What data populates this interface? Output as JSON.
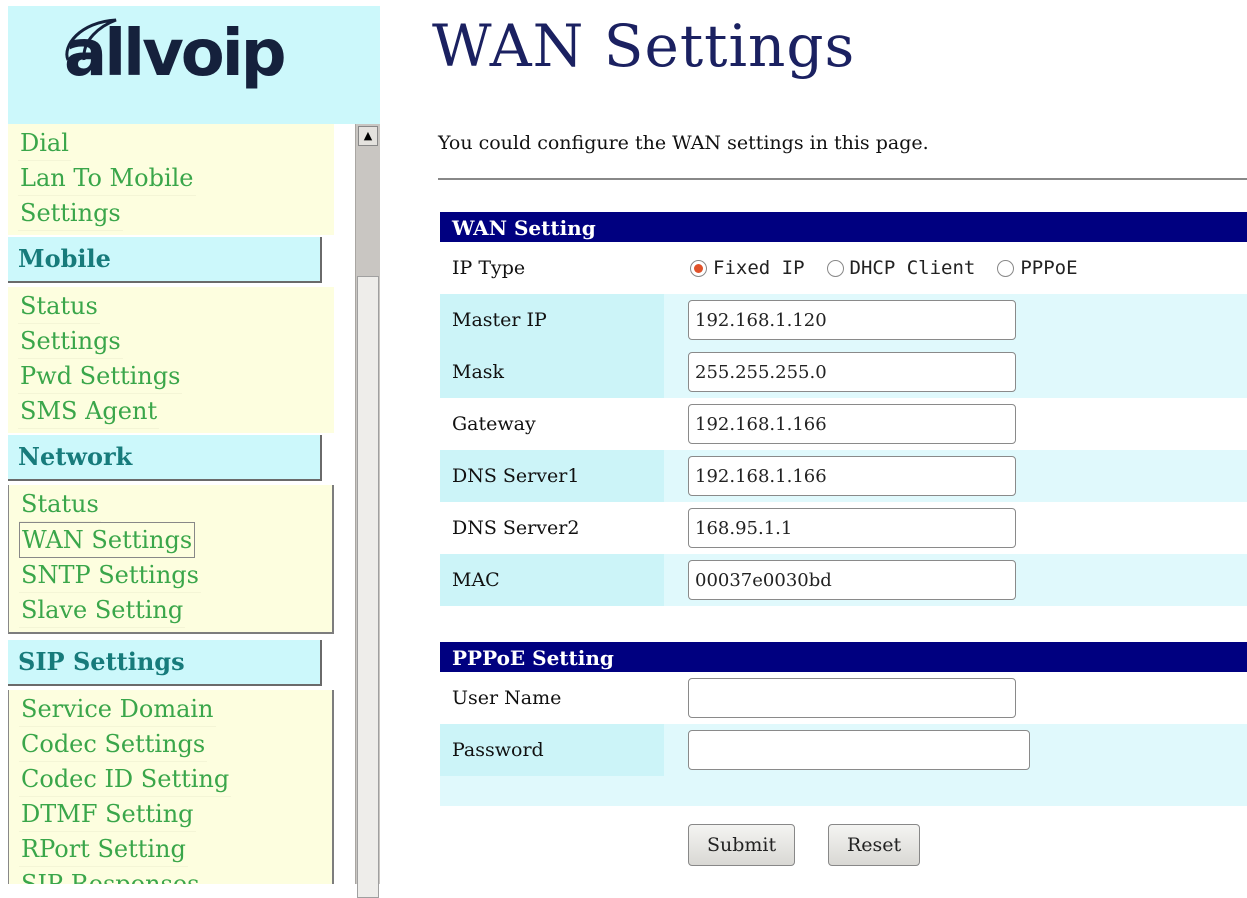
{
  "logo": {
    "text": "allvoip"
  },
  "sidebar": {
    "top_items": [
      "Dial",
      "Lan To Mobile",
      "Settings"
    ],
    "groups": [
      {
        "title": "Mobile",
        "items": [
          "Status",
          "Settings",
          "Pwd Settings",
          "SMS Agent"
        ]
      },
      {
        "title": "Network",
        "items": [
          "Status",
          "WAN Settings",
          "SNTP Settings",
          "Slave Setting"
        ]
      },
      {
        "title": "SIP Settings",
        "items": [
          "Service Domain",
          "Codec Settings",
          "Codec ID Setting",
          "DTMF Setting",
          "RPort Setting",
          "SIP Responses"
        ]
      }
    ],
    "active_item": "WAN Settings"
  },
  "main": {
    "title": "WAN Settings",
    "intro": "You could configure the WAN settings in this page."
  },
  "wan": {
    "header": "WAN Setting",
    "ip_type_label": "IP Type",
    "ip_type_options": [
      "Fixed IP",
      "DHCP Client",
      "PPPoE"
    ],
    "ip_type_selected": "Fixed IP",
    "master_ip_label": "Master IP",
    "master_ip": "192.168.1.120",
    "mask_label": "Mask",
    "mask": "255.255.255.0",
    "gateway_label": "Gateway",
    "gateway": "192.168.1.166",
    "dns1_label": "DNS Server1",
    "dns1": "192.168.1.166",
    "dns2_label": "DNS Server2",
    "dns2": "168.95.1.1",
    "mac_label": "MAC",
    "mac": "00037e0030bd"
  },
  "pppoe": {
    "header": "PPPoE Setting",
    "username_label": "User Name",
    "username": "",
    "password_label": "Password",
    "password": ""
  },
  "buttons": {
    "submit": "Submit",
    "reset": "Reset"
  },
  "colors": {
    "header_bg": "#000080",
    "menu_link": "#3aa64a",
    "title": "#1b2161"
  }
}
